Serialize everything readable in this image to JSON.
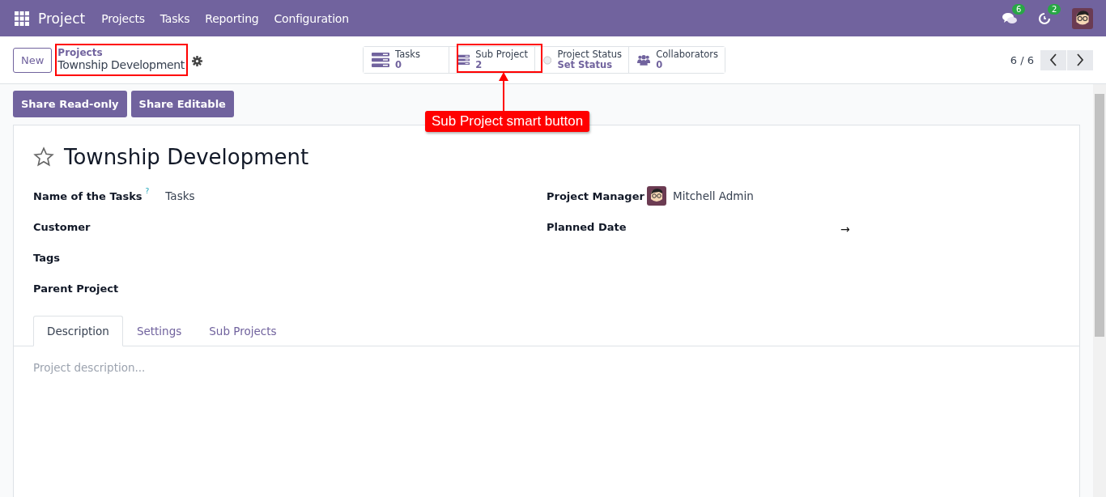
{
  "navbar": {
    "app_name": "Project",
    "menu": [
      "Projects",
      "Tasks",
      "Reporting",
      "Configuration"
    ],
    "messages_count": "6",
    "activities_count": "2"
  },
  "control_panel": {
    "new_button": "New",
    "breadcrumb_parent": "Projects",
    "breadcrumb_current": "Township Development",
    "pager": "6 / 6"
  },
  "smart_buttons": [
    {
      "kind": "stat",
      "label": "Tasks",
      "value": "0"
    },
    {
      "kind": "stat",
      "label": "Sub Project",
      "value": "2"
    },
    {
      "kind": "status",
      "label": "Project Status",
      "value": "Set Status"
    },
    {
      "kind": "people",
      "label": "Collaborators",
      "value": "0"
    }
  ],
  "actions": [
    "Share Read-only",
    "Share Editable"
  ],
  "annotation": {
    "callout": "Sub Project smart button"
  },
  "form": {
    "title": "Township Development",
    "favorite": false,
    "left_fields": [
      {
        "label": "Name of the Tasks",
        "help": "?",
        "value": "Tasks"
      },
      {
        "label": "Customer"
      },
      {
        "label": "Tags"
      },
      {
        "label": "Parent Project"
      }
    ],
    "right_fields": [
      {
        "kind": "user",
        "label": "Project Manager",
        "value": "Mitchell Admin"
      },
      {
        "kind": "daterange",
        "label": "Planned Date",
        "value": "→"
      }
    ],
    "tabs": [
      {
        "label": "Description",
        "selected": true
      },
      {
        "label": "Settings",
        "selected": false
      },
      {
        "label": "Sub Projects",
        "selected": false
      }
    ],
    "description_placeholder": "Project description..."
  }
}
